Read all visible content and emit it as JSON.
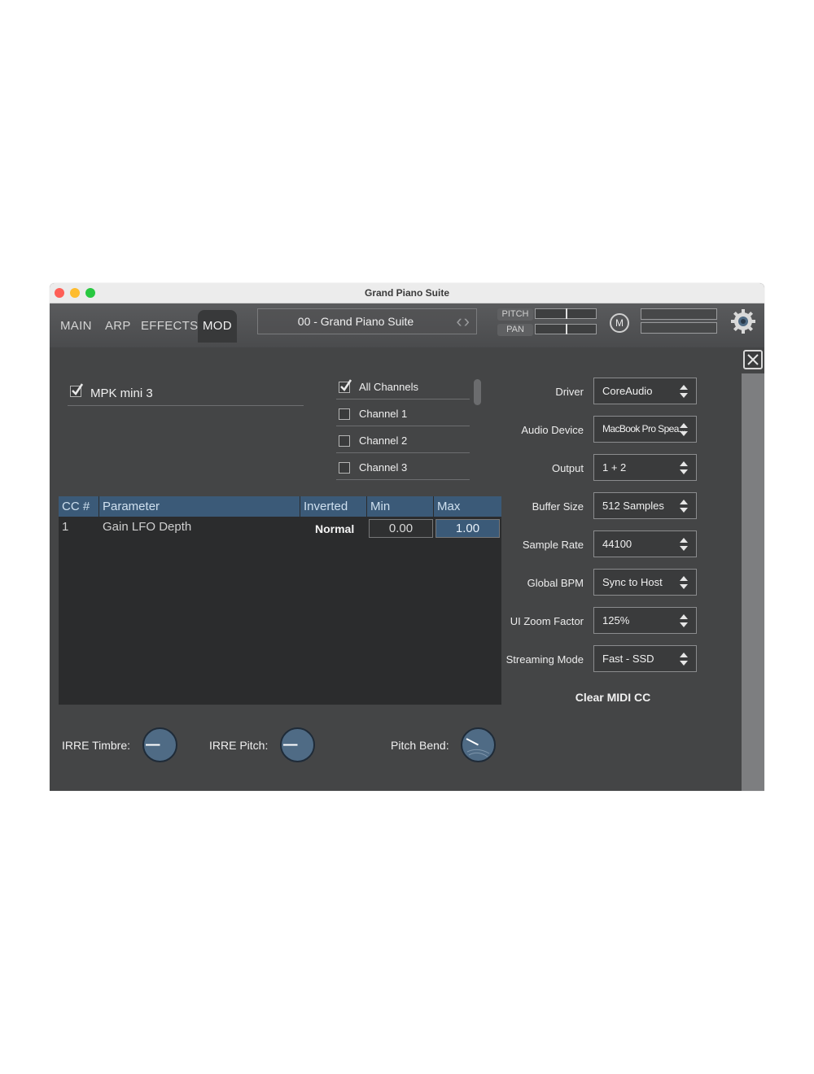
{
  "window": {
    "title": "Grand Piano Suite"
  },
  "tabs": [
    {
      "label": "MAIN"
    },
    {
      "label": "ARP"
    },
    {
      "label": "EFFECTS"
    },
    {
      "label": "MOD"
    }
  ],
  "preset": {
    "name": "00 - Grand Piano Suite"
  },
  "meters": {
    "pitch_label": "PITCH",
    "pan_label": "PAN"
  },
  "midi_button": "M",
  "device": {
    "name": "MPK mini 3",
    "checked": true
  },
  "channels": [
    {
      "label": "All Channels",
      "checked": true
    },
    {
      "label": "Channel 1",
      "checked": false
    },
    {
      "label": "Channel 2",
      "checked": false
    },
    {
      "label": "Channel 3",
      "checked": false
    }
  ],
  "cc_table": {
    "headers": [
      "CC #",
      "Parameter",
      "Inverted",
      "Min",
      "Max"
    ],
    "rows": [
      {
        "cc": "1",
        "parameter": "Gain LFO Depth",
        "inverted": "Normal",
        "min": "0.00",
        "max": "1.00"
      }
    ]
  },
  "settings": [
    {
      "label": "Driver",
      "value": "CoreAudio"
    },
    {
      "label": "Audio Device",
      "value": "MacBook Pro Spea..."
    },
    {
      "label": "Output",
      "value": "1 + 2"
    },
    {
      "label": "Buffer Size",
      "value": "512 Samples"
    },
    {
      "label": "Sample Rate",
      "value": "44100"
    },
    {
      "label": "Global BPM",
      "value": "Sync to Host"
    },
    {
      "label": "UI Zoom Factor",
      "value": "125%"
    },
    {
      "label": "Streaming Mode",
      "value": "Fast - SSD"
    }
  ],
  "clear_midi_label": "Clear MIDI CC",
  "knobs": [
    {
      "label": "IRRE Timbre:"
    },
    {
      "label": "IRRE Pitch:"
    },
    {
      "label": "Pitch Bend:"
    }
  ],
  "colors": {
    "panel": "#444546",
    "table_header": "#3b5a78",
    "knob": "#4f6b85"
  }
}
